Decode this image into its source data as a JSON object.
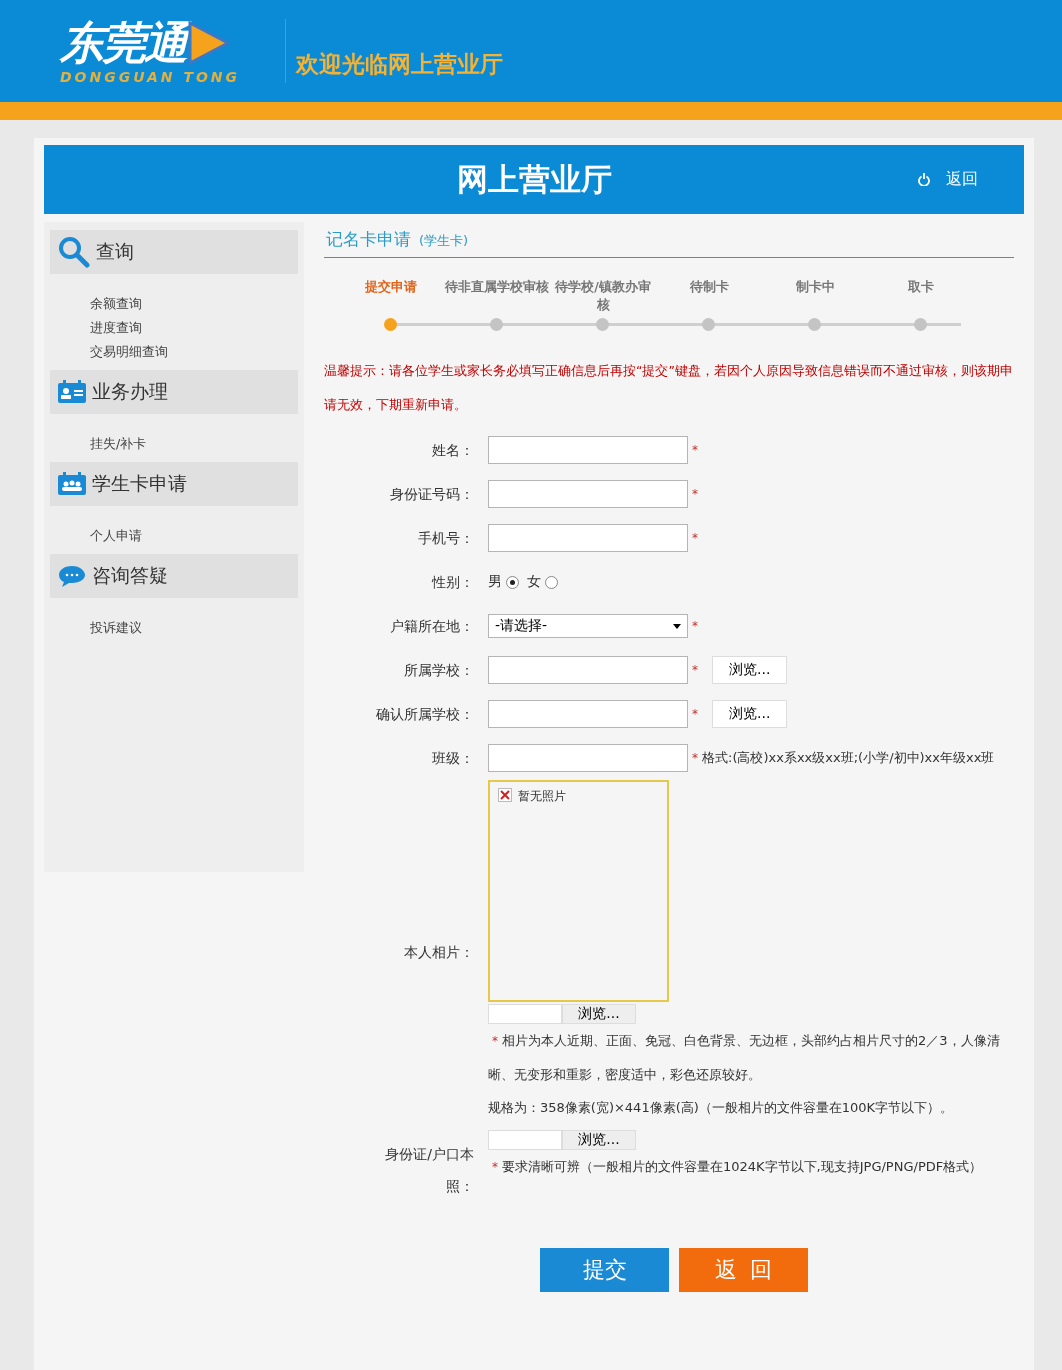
{
  "header": {
    "logo_text": "东莞通",
    "logo_subtitle": "DONGGUAN TONG",
    "welcome": "欢迎光临网上营业厅"
  },
  "title_bar": {
    "title": "网上营业厅",
    "back": "返回"
  },
  "sidebar": {
    "sections": [
      {
        "title": "查询",
        "items": [
          "余额查询",
          "进度查询",
          "交易明细查询"
        ]
      },
      {
        "title": "业务办理",
        "items": [
          "挂失/补卡"
        ]
      },
      {
        "title": "学生卡申请",
        "items": [
          "个人申请"
        ]
      },
      {
        "title": "咨询答疑",
        "items": [
          "投诉建议"
        ]
      }
    ]
  },
  "page_heading": {
    "title": "记名卡申请",
    "subtitle": "(学生卡)"
  },
  "steps": [
    {
      "label": "提交申请",
      "selected": true
    },
    {
      "label": "待非直属学校审核",
      "selected": false
    },
    {
      "label": "待学校/镇教办审核",
      "selected": false
    },
    {
      "label": "待制卡",
      "selected": false
    },
    {
      "label": "制卡中",
      "selected": false
    },
    {
      "label": "取卡",
      "selected": false
    }
  ],
  "notice": "温馨提示：请各位学生或家长务必填写正确信息后再按“提交”键盘，若因个人原因导致信息错误而不通过审核，则该期申请无效，下期重新申请。",
  "form": {
    "fields": [
      {
        "kind": "text",
        "label": "姓名：",
        "mark": "*"
      },
      {
        "kind": "text",
        "label": "身份证号码：",
        "mark": "*"
      },
      {
        "kind": "text",
        "label": "手机号：",
        "mark": "*"
      },
      {
        "kind": "radio",
        "label": "性别：",
        "options": [
          {
            "label": "男",
            "selected": true
          },
          {
            "label": "女",
            "selected": false
          }
        ]
      },
      {
        "kind": "select",
        "label": "户籍所在地：",
        "value": "-请选择-",
        "mark": "*"
      },
      {
        "kind": "browse",
        "label": "所属学校：",
        "mark": "*",
        "button": "浏览..."
      },
      {
        "kind": "browse",
        "label": "确认所属学校：",
        "mark": "*",
        "button": "浏览..."
      },
      {
        "kind": "hint",
        "label": "班级：",
        "mark": "*",
        "hint": "格式:(高校)xx系xx级xx班;(小学/初中)xx年级xx班"
      },
      {
        "kind": "photo",
        "label": "本人相片：",
        "placeholder_text": "暂无照片",
        "button": "浏览...",
        "mark": "*",
        "notes": [
          "相片为本人近期、正面、免冠、白色背景、无边框，头部约占相片尺寸的2／3，人像清晰、无变形和重影，密度适中，彩色还原较好。",
          "规格为：358像素(宽)×441像素(高)（一般相片的文件容量在100K字节以下）。"
        ]
      },
      {
        "kind": "upload",
        "label": "身份证/户口本照：",
        "button": "浏览...",
        "mark": "*",
        "notes": [
          "要求清晰可辨（一般相片的文件容量在1024K字节以下,现支持JPG/PNG/PDF格式）"
        ]
      }
    ]
  },
  "buttons": [
    {
      "kind": "submit",
      "label": "提交"
    },
    {
      "kind": "back",
      "label": "返  回"
    }
  ]
}
